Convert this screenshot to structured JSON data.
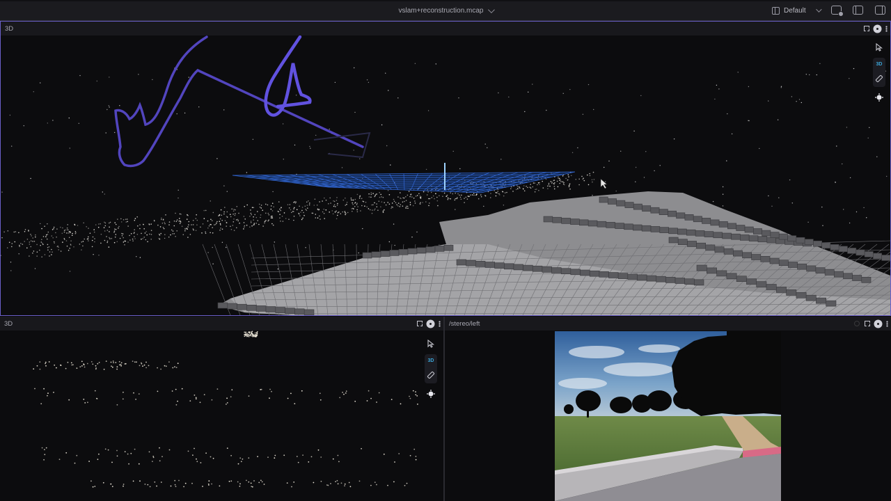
{
  "app": {
    "file_name": "vslam+reconstruction.mcap",
    "layout_label": "Default"
  },
  "panels": {
    "top": {
      "title": "3D",
      "tool_tag": "3D"
    },
    "bottom_left": {
      "title": "3D",
      "tool_tag": "3D"
    },
    "bottom_right": {
      "title": "/stereo/left"
    }
  },
  "icons": {
    "layout": "layout-icon",
    "add_panel": "add-panel-icon",
    "left_sidebar": "left-sidebar-icon",
    "right_sidebar": "right-sidebar-icon",
    "maximize": "maximize-icon",
    "settings": "gear-icon",
    "more": "more-vertical-icon",
    "select": "pointer-icon",
    "measure": "ruler-icon",
    "publish": "crosshair-icon"
  },
  "colors": {
    "accent_border": "#6a5fc8",
    "trajectory": "#5a4bd1",
    "grid": "#3c7bff",
    "tool_tag": "#3aa6d9"
  }
}
